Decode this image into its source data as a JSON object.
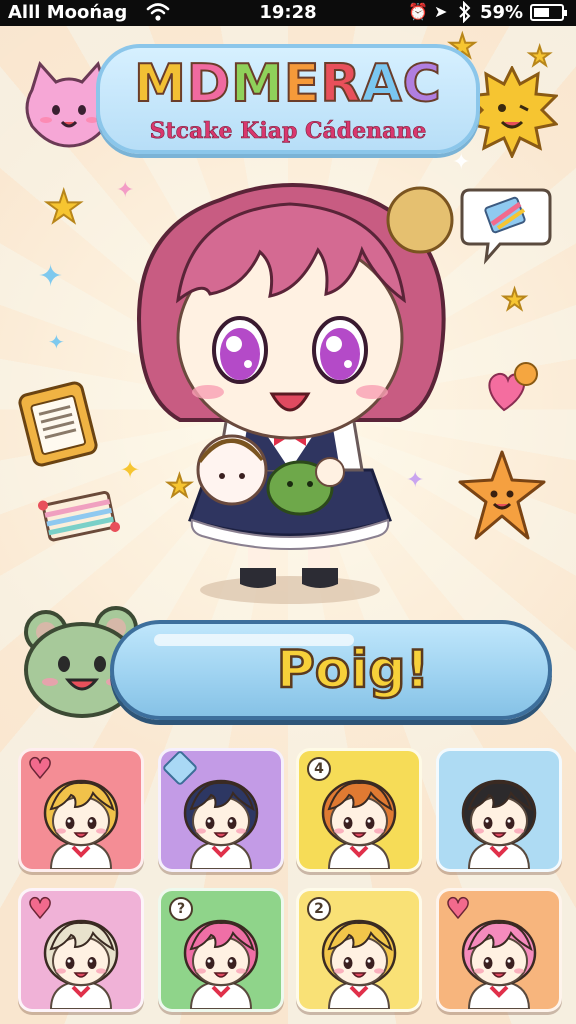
{
  "status_bar": {
    "carrier": "Alll Moońag",
    "time": "19:28",
    "battery": "59%",
    "battery_level": 0.59,
    "icons": [
      "wifi-icon",
      "alarm-icon",
      "location-icon",
      "bluetooth-icon",
      "battery-icon"
    ]
  },
  "title": {
    "main_letters": [
      "M",
      "D",
      "M",
      "E",
      "R",
      "A",
      "C"
    ],
    "main_colors": [
      "#f2c034",
      "#f06aa0",
      "#8fd15a",
      "#f59a3a",
      "#e8505b",
      "#7ac7f0",
      "#b07ee0"
    ],
    "subtitle": "Stcake Kiap Cádenane"
  },
  "play_button": {
    "label": "Poig!"
  },
  "characters": [
    {
      "badge": "heart",
      "bg": "#f48d95",
      "hair": "#f1c24a"
    },
    {
      "badge": "gem",
      "bg": "#c39be6",
      "hair": "#2d3763"
    },
    {
      "badge": "4",
      "bg": "#f6dc57",
      "hair": "#e07a32"
    },
    {
      "badge": "",
      "bg": "#aedbf3",
      "hair": "#2c2a2c"
    },
    {
      "badge": "heart",
      "bg": "#f0b2d7",
      "hair": "#e8e2cc"
    },
    {
      "badge": "?",
      "bg": "#8fd48a",
      "hair": "#ef6fa6"
    },
    {
      "badge": "2",
      "bg": "#f9e176",
      "hair": "#f2c64a"
    },
    {
      "badge": "heart",
      "bg": "#f7b57d",
      "hair": "#f58bbd"
    }
  ]
}
